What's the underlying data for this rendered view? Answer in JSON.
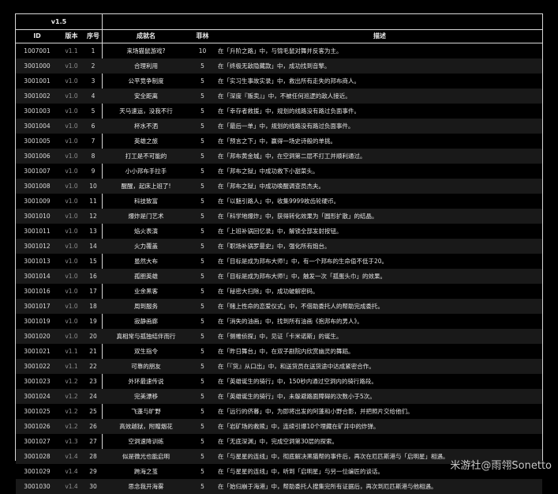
{
  "version_header": "v1.5",
  "columns": {
    "id": "ID",
    "version": "版本",
    "seq": "序号",
    "name": "成就名",
    "gems": "菲林",
    "desc": "描述"
  },
  "rows": [
    {
      "id": "1007001",
      "version": "v1.1",
      "seq": "1",
      "name": "来场猫鼠游戏?",
      "gems": "10",
      "desc": "在「升阶之路」中，与锦毛鼠对舞并反客为主。"
    },
    {
      "id": "3001000",
      "version": "v1.0",
      "seq": "2",
      "name": "合理利用",
      "gems": "5",
      "desc": "在「终极无敌隐藏款」中，成功找到音擎。"
    },
    {
      "id": "3001001",
      "version": "v1.0",
      "seq": "3",
      "name": "公平竞争制度",
      "gems": "5",
      "desc": "在「实习生事故实录」中，救出所有走失的邦布商人。"
    },
    {
      "id": "3001002",
      "version": "v1.0",
      "seq": "4",
      "name": "安全距离",
      "gems": "5",
      "desc": "在「深度『贩卖』」中，不被任何巡逻的敌人接近。"
    },
    {
      "id": "3001003",
      "version": "v1.0",
      "seq": "5",
      "name": "天马速运，没我不行",
      "gems": "5",
      "desc": "在「幸存者救援」中，规划的线路没有路过负面事件。"
    },
    {
      "id": "3001004",
      "version": "v1.0",
      "seq": "6",
      "name": "杯水不洒",
      "gems": "5",
      "desc": "在「最后一单」中，规划的线路没有路过负面事件。"
    },
    {
      "id": "3001005",
      "version": "v1.0",
      "seq": "7",
      "name": "英雄之旅",
      "gems": "5",
      "desc": "在「预言之下」中，赢得一场史诗般的单挑。"
    },
    {
      "id": "3001006",
      "version": "v1.0",
      "seq": "8",
      "name": "打工是不可能的",
      "gems": "5",
      "desc": "在「邦布黄金城」中，在空洞第二层不打工并顺利通过。"
    },
    {
      "id": "3001007",
      "version": "v1.0",
      "seq": "9",
      "name": "小小邦布手拉手",
      "gems": "5",
      "desc": "在「邦布之狱」中成功救下小甜菜头。"
    },
    {
      "id": "3001008",
      "version": "v1.0",
      "seq": "10",
      "name": "醒醒，起床上班了!",
      "gems": "5",
      "desc": "在「邦布之狱」中成功唤醒调查员杰夫。"
    },
    {
      "id": "3001009",
      "version": "v1.0",
      "seq": "11",
      "name": "科技致富",
      "gems": "5",
      "desc": "在「以魅引路人」中，收集9999枚齿轮硬币。"
    },
    {
      "id": "3001010",
      "version": "v1.0",
      "seq": "12",
      "name": "爆炸是门艺术",
      "gems": "5",
      "desc": "在「科学地爆炸」中，获得转化效果为「圆形扩散」的结晶。"
    },
    {
      "id": "3001011",
      "version": "v1.0",
      "seq": "13",
      "name": "焰火表演",
      "gems": "5",
      "desc": "在「上班补锅回忆录」中，解锁全部发射按钮。"
    },
    {
      "id": "3001012",
      "version": "v1.0",
      "seq": "14",
      "name": "火力覆盖",
      "gems": "5",
      "desc": "在「职场补锅罗曼史」中，强化所有炮台。"
    },
    {
      "id": "3001013",
      "version": "v1.0",
      "seq": "15",
      "name": "虽然大布",
      "gems": "5",
      "desc": "在「目标是成为邦布大师!」中，有一个邦布的生命值不低于20。"
    },
    {
      "id": "3001014",
      "version": "v1.0",
      "seq": "16",
      "name": "孤胆英雄",
      "gems": "5",
      "desc": "在「目标是成为邦布大师!」中，触发一次「孤蛋头巾」的效果。"
    },
    {
      "id": "3001016",
      "version": "v1.0",
      "seq": "17",
      "name": "业余黑客",
      "gems": "5",
      "desc": "在「秘密大扫除」中，成功破解密码。"
    },
    {
      "id": "3001017",
      "version": "v1.0",
      "seq": "18",
      "name": "周到服务",
      "gems": "5",
      "desc": "在「赌上性命的恋爱仪式」中，不借助委托人的帮助完成委托。"
    },
    {
      "id": "3001019",
      "version": "v1.0",
      "seq": "19",
      "name": "寂静画廊",
      "gems": "5",
      "desc": "在「消失的油画」中，找到所有油画《抱邦布的男人》。"
    },
    {
      "id": "3001020",
      "version": "v1.0",
      "seq": "20",
      "name": "真相常与孤独结伴而行",
      "gems": "5",
      "desc": "在「侧帷侦探」中，见证「卡米诺斯」的诞生。"
    },
    {
      "id": "3001021",
      "version": "v1.1",
      "seq": "21",
      "name": "双生指令",
      "gems": "5",
      "desc": "在「昨日舞台」中，在双子剧院内欣赏幽灵的舞蹈。"
    },
    {
      "id": "3001022",
      "version": "v1.1",
      "seq": "22",
      "name": "可靠的朋友",
      "gems": "5",
      "desc": "在「『货』从口出」中，和送货员在送货途中达成紧密合作。"
    },
    {
      "id": "3001023",
      "version": "v1.2",
      "seq": "23",
      "name": "外环最速传说",
      "gems": "5",
      "desc": "在「英雄诞生的骑行」中，150秒内通过空洞内的骑行路段。"
    },
    {
      "id": "3001024",
      "version": "v1.2",
      "seq": "24",
      "name": "完美漂移",
      "gems": "5",
      "desc": "在「英雄诞生的骑行」中，未躲避路面障碍的次数小于5次。"
    },
    {
      "id": "3001025",
      "version": "v1.2",
      "seq": "25",
      "name": "飞蓬与旷野",
      "gems": "5",
      "desc": "在「远行的侪暮」中，为即将出发的阿蓬和小野合影，并把照片交给他们。"
    },
    {
      "id": "3001026",
      "version": "v1.2",
      "seq": "26",
      "name": "高效越狱，附赠烟花",
      "gems": "5",
      "desc": "在「岩矿场的救赎」中，连续引爆10个埋藏在矿井中的炸弹。"
    },
    {
      "id": "3001027",
      "version": "v1.3",
      "seq": "27",
      "name": "空洞速降训练",
      "gems": "5",
      "desc": "在「无底深渊」中，完成空洞第30层的探索。"
    },
    {
      "id": "3001028",
      "version": "v1.4",
      "seq": "28",
      "name": "似是微光也能启明",
      "gems": "5",
      "desc": "在「与星星的连线」中，彻底解决黑猫帮的事件后，再次在厄匹斯港与「启明星」相遇。"
    },
    {
      "id": "3001029",
      "version": "v1.4",
      "seq": "29",
      "name": "跨海之茧",
      "gems": "5",
      "desc": "在「与星星的连线」中，听到「启明星」与另一位编匠的谈话。"
    },
    {
      "id": "3001030",
      "version": "v1.4",
      "seq": "30",
      "name": "思念我开海雾",
      "gems": "5",
      "desc": "在「始归崩于海港」中，帮助委托人搜集完所有证据后，再次到厄匹斯港与他相遇。"
    }
  ],
  "watermark": "米游社@雨翎Sonetto"
}
